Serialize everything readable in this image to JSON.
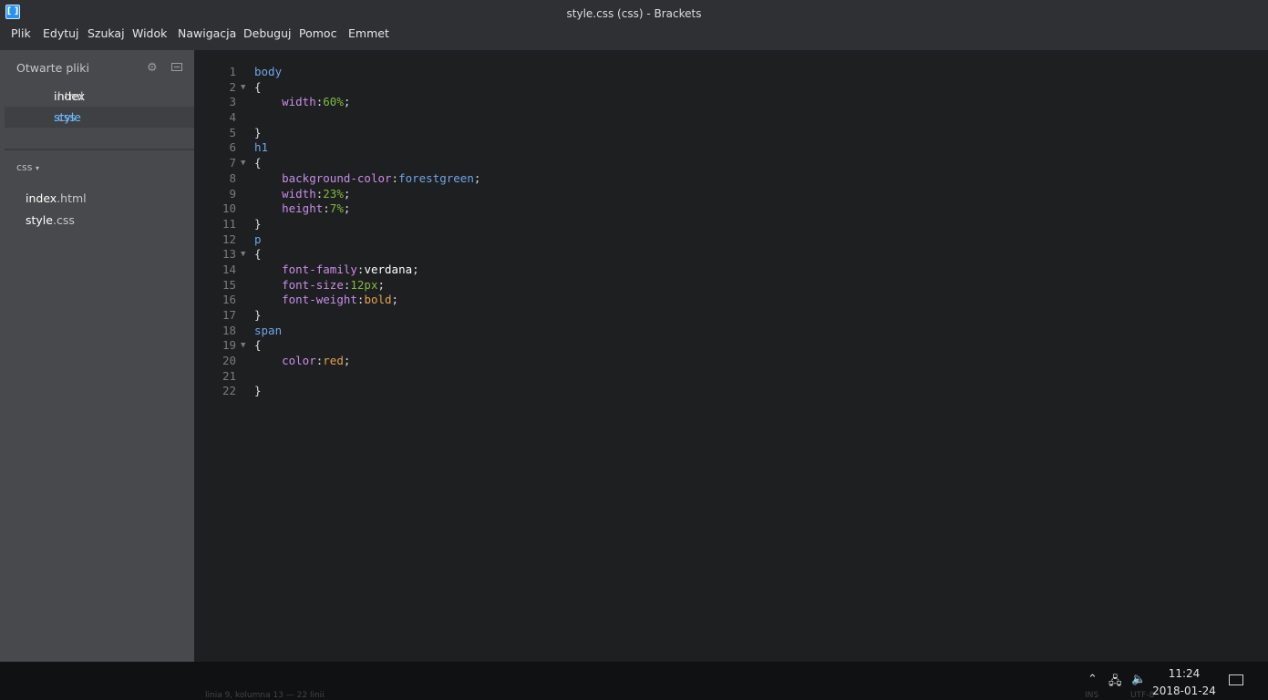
{
  "window": {
    "title": "style.css (css) - Brackets",
    "app_icon": "brackets-logo-icon"
  },
  "menu": [
    "Plik",
    "Edytuj",
    "Szukaj",
    "Widok",
    "Nawigacja",
    "Debuguj",
    "Pomoc",
    "Emmet"
  ],
  "sidebar": {
    "open_files_label": "Otwarte pliki",
    "open_files": [
      {
        "name": "index",
        "ext": ".html",
        "active": false
      },
      {
        "name": "style",
        "ext": ".css",
        "active": true
      }
    ],
    "project": "css",
    "project_arrow": "▾",
    "tree": [
      {
        "name": "index",
        "ext": ".html"
      },
      {
        "name": "style",
        "ext": ".css"
      }
    ]
  },
  "editor": {
    "lines": [
      "1",
      "2",
      "3",
      "4",
      "5",
      "6",
      "7",
      "8",
      "9",
      "10",
      "11",
      "12",
      "13",
      "14",
      "15",
      "16",
      "17",
      "18",
      "19",
      "20",
      "21",
      "22"
    ]
  },
  "status": {
    "cursor": "linia 9, kolumna 13 — 22 linii",
    "ins": "INS",
    "encoding": "UTF-8"
  },
  "taskbar": {
    "time": "11:24",
    "date": "2018-01-24"
  },
  "colors": {
    "selector": "#6fa6e8",
    "property": "#c88ee6",
    "number": "#83b83e",
    "keyword_value": "#e4a34d"
  }
}
